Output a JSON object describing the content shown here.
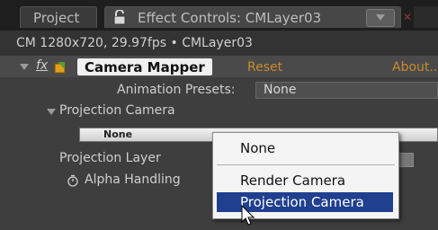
{
  "tabs": {
    "project_label": "Project",
    "effect_controls_label": "Effect Controls: CMLayer03"
  },
  "subtitle": "CM 1280x720, 29.97fps • CMLayer03",
  "effect": {
    "fx_label": "fx",
    "name": "Camera Mapper",
    "reset_label": "Reset",
    "about_label": "About..."
  },
  "rows": {
    "animation_presets_label": "Animation Presets:",
    "animation_presets_value": "None",
    "projection_camera_label": "Projection Camera",
    "projection_camera_value": "None",
    "projection_layer_label": "Projection Layer",
    "alpha_handling_label": "Alpha Handling"
  },
  "dropdown": {
    "items": [
      "None",
      "Render Camera",
      "Projection Camera"
    ],
    "selected": "Projection Camera"
  },
  "colors": {
    "accent_link": "#c98a2c",
    "selection": "#1f3f8f"
  }
}
